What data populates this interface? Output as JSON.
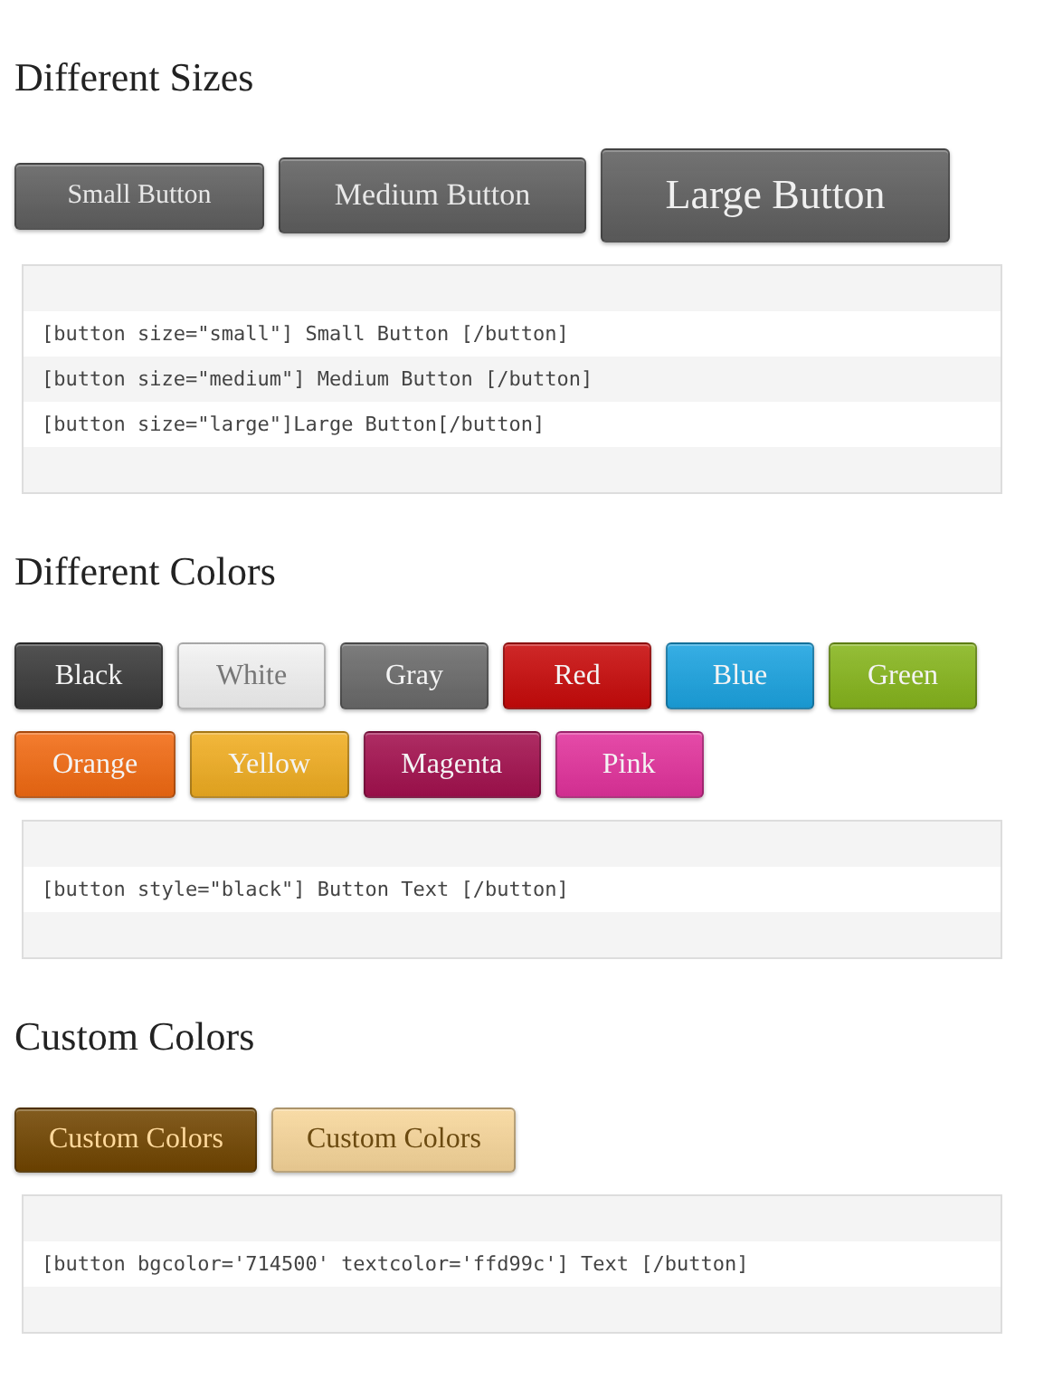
{
  "sections": [
    {
      "heading": "Different Sizes",
      "button_rows": [
        [
          {
            "label": "Small Button",
            "kind": "small",
            "color": "#5f5f5f"
          },
          {
            "label": "Medium Button",
            "kind": "medium",
            "color": "#5f5f5f"
          },
          {
            "label": "Large Button",
            "kind": "large",
            "color": "#5f5f5f"
          }
        ]
      ],
      "code_lines": [
        "[button size=\"small\"] Small Button [/button]",
        "[button size=\"medium\"] Medium Button [/button]",
        "[button size=\"large\"]Large Button[/button]"
      ]
    },
    {
      "heading": "Different Colors",
      "button_rows": [
        [
          {
            "label": "Black",
            "kind": "dark",
            "color": "#3a3a3a"
          },
          {
            "label": "White",
            "kind": "light",
            "color": "#f2f2f2"
          },
          {
            "label": "Gray",
            "kind": "dark",
            "color": "#6a6a6a"
          },
          {
            "label": "Red",
            "kind": "dark",
            "color": "#c80a0a"
          },
          {
            "label": "Blue",
            "kind": "dark",
            "color": "#1ba3e0"
          },
          {
            "label": "Green",
            "kind": "dark",
            "color": "#86b51c"
          }
        ],
        [
          {
            "label": "Orange",
            "kind": "dark",
            "color": "#f26a12"
          },
          {
            "label": "Yellow",
            "kind": "dark",
            "color": "#f0ad21"
          },
          {
            "label": "Magenta",
            "kind": "dark",
            "color": "#a3104e"
          },
          {
            "label": "Pink",
            "kind": "dark",
            "color": "#e2329c"
          }
        ]
      ],
      "code_lines": [
        "[button style=\"black\"] Button Text [/button]"
      ]
    },
    {
      "heading": "Custom Colors",
      "button_rows": [
        [
          {
            "label": "Custom Colors",
            "kind": "custom_dark",
            "color": "#714500"
          },
          {
            "label": "Custom Colors",
            "kind": "custom_light",
            "color": "#f7d69a"
          }
        ]
      ],
      "code_lines": [
        "[button bgcolor='714500' textcolor='ffd99c'] Text [/button]"
      ]
    }
  ]
}
